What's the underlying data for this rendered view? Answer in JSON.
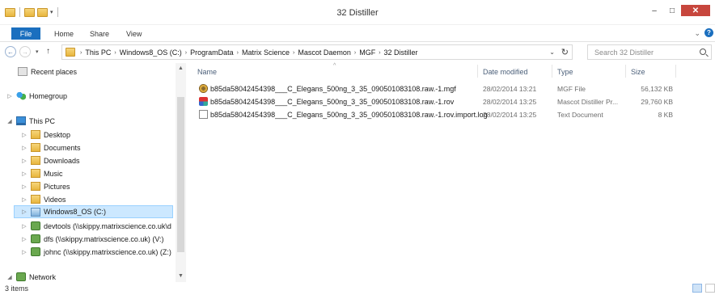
{
  "window": {
    "title": "32 Distiller"
  },
  "ribbon": {
    "tabs": {
      "file": "File",
      "home": "Home",
      "share": "Share",
      "view": "View"
    }
  },
  "address": {
    "crumbs": [
      "This PC",
      "Windows8_OS (C:)",
      "ProgramData",
      "Matrix Science",
      "Mascot Daemon",
      "MGF",
      "32 Distiller"
    ]
  },
  "search": {
    "placeholder": "Search 32 Distiller"
  },
  "navpane": {
    "recent": "Recent places",
    "homegroup": "Homegroup",
    "thispc": "This PC",
    "desktop": "Desktop",
    "documents": "Documents",
    "downloads": "Downloads",
    "music": "Music",
    "pictures": "Pictures",
    "videos": "Videos",
    "windows_os": "Windows8_OS (C:)",
    "devtools": "devtools (\\\\skippy.matrixscience.co.uk\\d",
    "dfs": "dfs (\\\\skippy.matrixscience.co.uk) (V:)",
    "johnc": "johnc (\\\\skippy.matrixscience.co.uk) (Z:)",
    "network": "Network"
  },
  "columns": {
    "name": "Name",
    "date": "Date modified",
    "type": "Type",
    "size": "Size"
  },
  "files": [
    {
      "name": "b85da58042454398___C_Elegans_500ng_3_35_090501083108.raw.-1.mgf",
      "date": "28/02/2014 13:21",
      "type": "MGF File",
      "size": "56,132 KB",
      "icon": "mgf-icon"
    },
    {
      "name": "b85da58042454398___C_Elegans_500ng_3_35_090501083108.raw.-1.rov",
      "date": "28/02/2014 13:25",
      "type": "Mascot Distiller Pr...",
      "size": "29,760 KB",
      "icon": "rov-icon"
    },
    {
      "name": "b85da58042454398___C_Elegans_500ng_3_35_090501083108.raw.-1.rov.import.log",
      "date": "28/02/2014 13:25",
      "type": "Text Document",
      "size": "8 KB",
      "icon": "log-icon"
    }
  ],
  "status": {
    "count": "3 items"
  }
}
